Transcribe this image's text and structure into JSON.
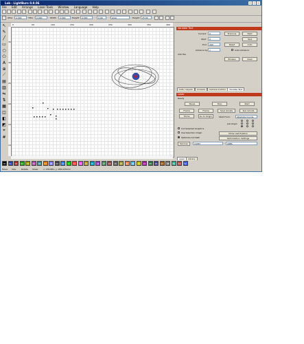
{
  "window": {
    "title": "Lab - LightBurn 0.9.06"
  },
  "menu": [
    "File",
    "Edit",
    "Arrange",
    "Laser Tools",
    "Window",
    "Language",
    "Help"
  ],
  "toolbar2": {
    "x_label": "XPos",
    "x_val": "0.000",
    "y_label": "YPos",
    "y_val": "0.000",
    "w_label": "Width",
    "w_val": "0.000",
    "h_label": "Height",
    "h_val": "0.000",
    "rot_val": "0.00",
    "font": "Arial",
    "height_label": "Height",
    "height_val": "25.00"
  },
  "ruler_top": [
    "0",
    "50",
    "100",
    "150",
    "200",
    "250",
    "300",
    "350",
    "400"
  ],
  "ruler_left": [
    "350",
    "300",
    "250",
    "200",
    "150",
    "100"
  ],
  "variable_text": {
    "header": "Variable Text",
    "current_label": "Current",
    "current_val": "0",
    "start_label": "Start",
    "start_val": "0",
    "end_label": "End",
    "end_val": "999",
    "advance_label": "Advance by",
    "advance_val": "1",
    "csv_label": "CSV File",
    "previous": "Previous",
    "next": "Next",
    "test": "Test",
    "reset": "Reset",
    "auto": "Auto",
    "auto_advance": "Auto-Advance",
    "browse": "Browse",
    "clear": "Clear"
  },
  "mid_tabs": [
    "Cuts / Layers",
    "Console",
    "Camera Control",
    "Variable Text"
  ],
  "laser": {
    "header": "Laser",
    "status": "Ready",
    "pause": "Pause",
    "stop": "Stop",
    "start": "Start",
    "frame": "Frame",
    "frame2": "Frame",
    "save_gcode": "Save GCode",
    "run_gcode": "Run GCode",
    "home": "Home",
    "go_origin": "Go to Origin",
    "start_from_label": "Start From:",
    "start_from_val": "Absolute Coords",
    "job_origin_label": "Job Origin",
    "cut_selected": "Cut Selected Graphics",
    "use_selection_origin": "Use Selection Origin",
    "optimize_cut_path": "Optimize Cut Path",
    "show_last_position": "Show Last Position",
    "optimization_settings": "Optimization Settings",
    "devices": "Devices",
    "port": "COM3",
    "device": "GRBL"
  },
  "bottom_tabs": [
    "Laser",
    "Library"
  ],
  "palette": [
    {
      "label": "00",
      "color": "#000000"
    },
    {
      "label": "01",
      "color": "#2040c0"
    },
    {
      "label": "02",
      "color": "#c02020"
    },
    {
      "label": "03",
      "color": "#20a020"
    },
    {
      "label": "04",
      "color": "#a0a000"
    },
    {
      "label": "05",
      "color": "#c040c0"
    },
    {
      "label": "06",
      "color": "#20a0a0"
    },
    {
      "label": "07",
      "color": "#e08000"
    },
    {
      "label": "08",
      "color": "#8080ff"
    },
    {
      "label": "09",
      "color": "#404040"
    },
    {
      "label": "10",
      "color": "#2080ff"
    },
    {
      "label": "11",
      "color": "#00c000"
    },
    {
      "label": "12",
      "color": "#ff4040"
    },
    {
      "label": "13",
      "color": "#ff40ff"
    },
    {
      "label": "14",
      "color": "#c0a000"
    },
    {
      "label": "15",
      "color": "#00a0c0"
    },
    {
      "label": "16",
      "color": "#9040c0"
    },
    {
      "label": "17",
      "color": "#40a060"
    },
    {
      "label": "18",
      "color": "#b04040"
    },
    {
      "label": "19",
      "color": "#606060"
    },
    {
      "label": "20",
      "color": "#a0a040"
    },
    {
      "label": "21",
      "color": "#ff8040"
    },
    {
      "label": "22",
      "color": "#40c0ff"
    },
    {
      "label": "23",
      "color": "#c0c000"
    },
    {
      "label": "24",
      "color": "#a020a0"
    },
    {
      "label": "25",
      "color": "#208040"
    },
    {
      "label": "26",
      "color": "#4040a0"
    },
    {
      "label": "27",
      "color": "#a06020"
    },
    {
      "label": "28",
      "color": "#808080"
    },
    {
      "label": "29",
      "color": "#20c0a0"
    },
    {
      "label": "T1",
      "color": "#e04040"
    },
    {
      "label": "T2",
      "color": "#4060e0"
    }
  ],
  "status": {
    "move": "Move",
    "size": "Size",
    "rotate": "Rotate",
    "shear": "Shear",
    "coords": "x: 235.881, y: 282.035mm"
  }
}
